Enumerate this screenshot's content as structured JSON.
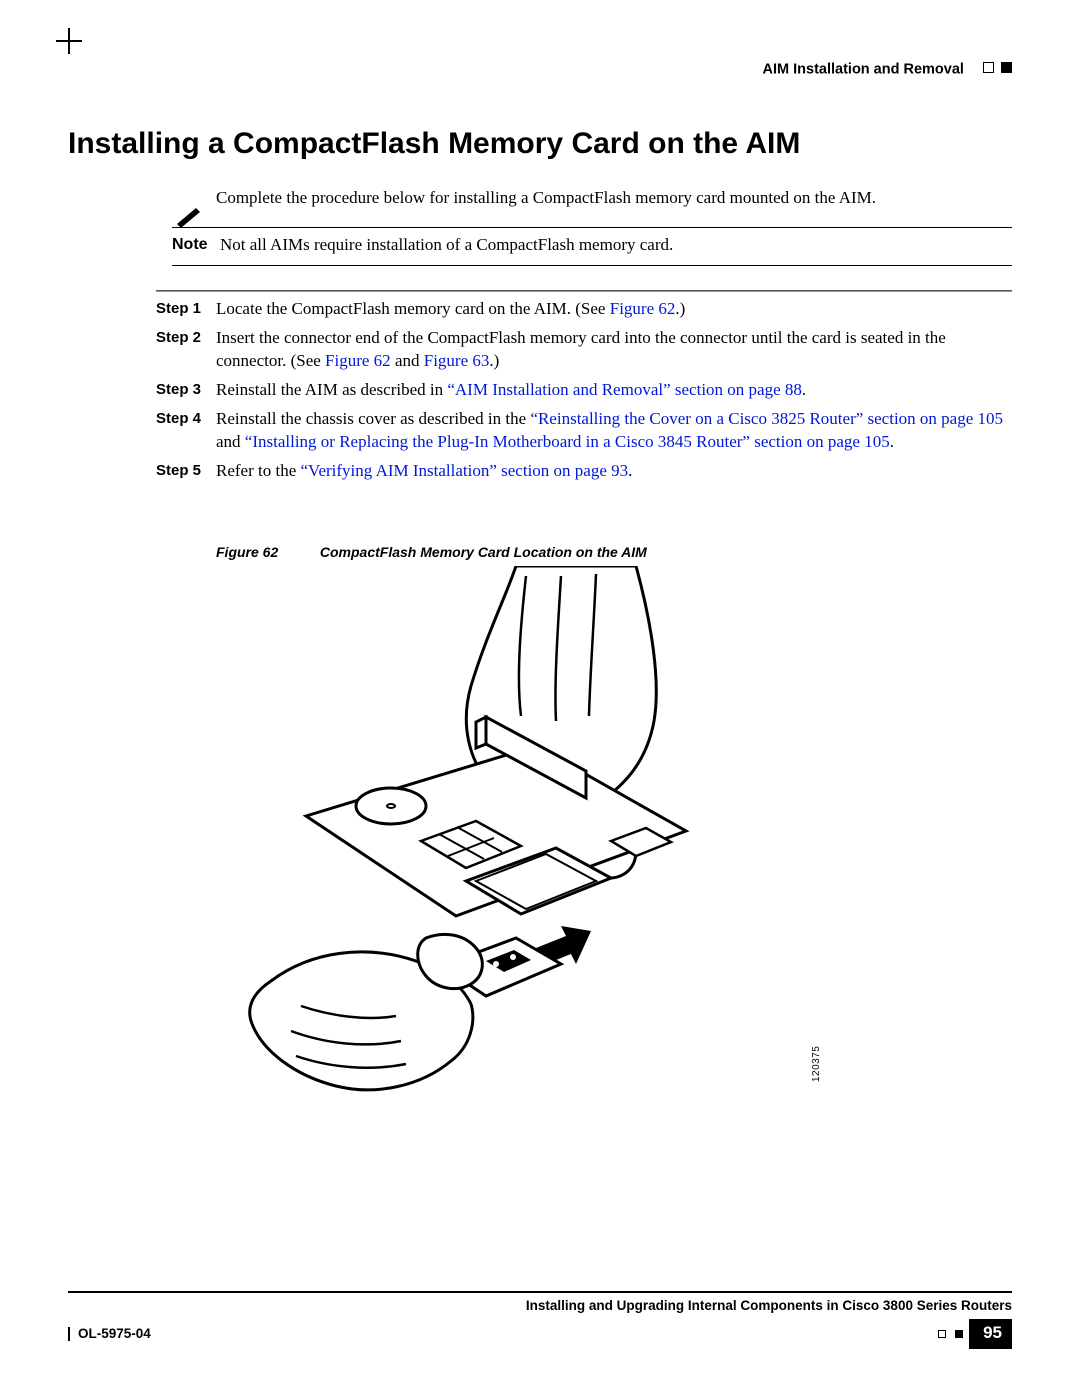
{
  "header": {
    "right_text": "AIM Installation and Removal"
  },
  "title": "Installing a CompactFlash Memory Card on the AIM",
  "intro": "Complete the procedure below for installing a CompactFlash memory card mounted on the AIM.",
  "note": {
    "label": "Note",
    "text": "Not all AIMs require installation of a CompactFlash memory card."
  },
  "steps": [
    {
      "label": "Step 1",
      "pre": "Locate the CompactFlash memory card on the AIM. (See ",
      "link1": "Figure 62",
      "post": ".)"
    },
    {
      "label": "Step 2",
      "pre": "Insert the connector end of the CompactFlash memory card into the connector until the card is seated in the connector. (See ",
      "link1": "Figure 62",
      "mid": " and ",
      "link2": "Figure 63",
      "post": ".)"
    },
    {
      "label": "Step 3",
      "pre": "Reinstall the AIM as described in ",
      "link1": "“AIM Installation and Removal” section on page 88",
      "post": "."
    },
    {
      "label": "Step 4",
      "pre": "Reinstall the chassis cover as described in the ",
      "link1": "“Reinstalling the Cover on a Cisco 3825 Router” section on page 105",
      "mid": " and ",
      "link2": "“Installing or Replacing the Plug-In Motherboard in a Cisco 3845 Router” section on page 105",
      "post": "."
    },
    {
      "label": "Step 5",
      "pre": "Refer to the ",
      "link1": "“Verifying AIM Installation” section on page 93",
      "post": "."
    }
  ],
  "figure": {
    "label": "Figure 62",
    "title": "CompactFlash Memory Card Location on the AIM",
    "art_number": "120375"
  },
  "footer": {
    "book_title": "Installing and Upgrading Internal Components in Cisco 3800 Series Routers",
    "doc_id": "OL-5975-04",
    "page_number": "95"
  }
}
